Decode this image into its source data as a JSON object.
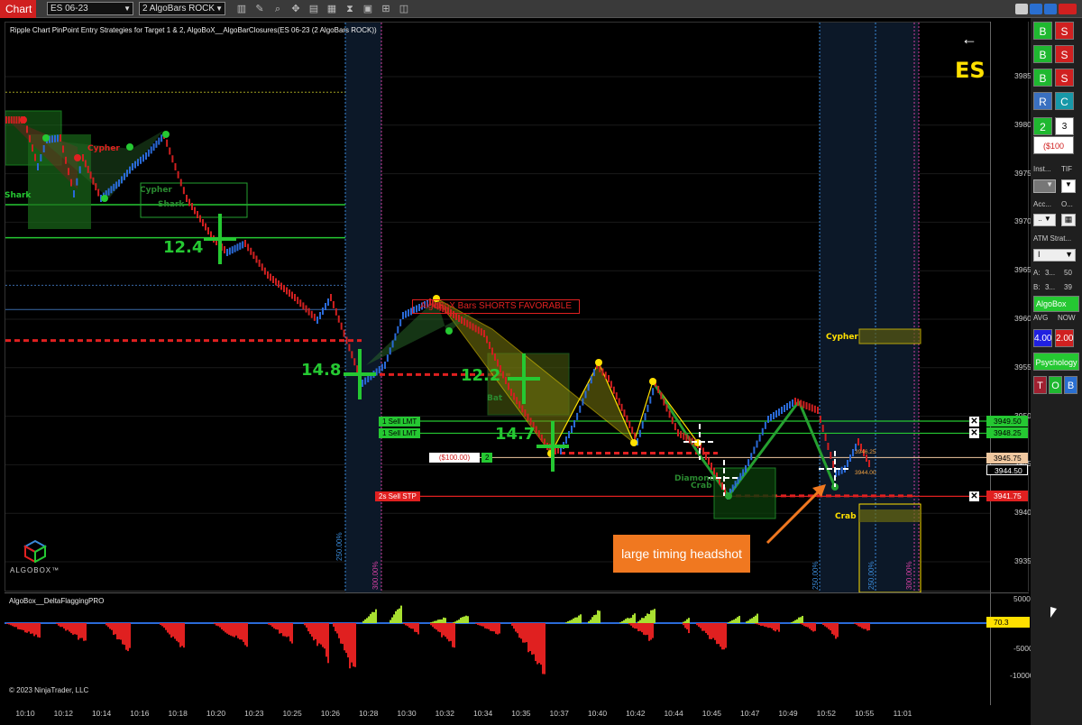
{
  "toolbar": {
    "tab_label": "Chart",
    "instrument": "ES 06-23",
    "bar_type": "2 AlgoBars ROCK",
    "icons": [
      "bar-style-icon",
      "draw-icon",
      "zoom-icon",
      "pointer-icon",
      "page-icon",
      "properties-icon",
      "strategy-icon",
      "template-icon",
      "chart-trader-icon",
      "global-icon"
    ]
  },
  "chart": {
    "title": "Ripple Chart PinPoint Entry Strategies for Target 1 & 2, AlgoBoX__AlgoBarClosures(ES 06-23 (2 AlgoBars ROCK))",
    "symbol_badge": "ES",
    "y_ticks": [
      "3985.00",
      "3980.00",
      "3975.00",
      "3970.00",
      "3965.00",
      "3960.00",
      "3955.00",
      "3950.00",
      "3945.00",
      "3940.00",
      "3935.00"
    ],
    "x_ticks": [
      "10:10",
      "10:12",
      "10:14",
      "10:16",
      "10:18",
      "10:20",
      "10:23",
      "10:25",
      "10:26",
      "10:28",
      "10:30",
      "10:32",
      "10:34",
      "10:35",
      "10:37",
      "10:40",
      "10:42",
      "10:44",
      "10:45",
      "10:47",
      "10:49",
      "10:52",
      "10:55",
      "11:01"
    ],
    "price_tags": [
      {
        "value": "3949.50",
        "color": "#25c832"
      },
      {
        "value": "3948.25",
        "color": "#25c832"
      },
      {
        "value": "3945.75",
        "color": "#f0c8a0"
      },
      {
        "value": "3944.50",
        "color": "#ffffff"
      },
      {
        "value": "3941.75",
        "color": "#e02020"
      }
    ],
    "orders": {
      "sell_lmt_1": "1  Sell LMT",
      "sell_lmt_2": "1  Sell LMT",
      "pnl": "($100.00)",
      "pnl_qty": "2",
      "sell_stp": "2s  Sell STP"
    },
    "small_levels": [
      "3946.25",
      "3944.00"
    ],
    "big_numbers": [
      "12.4",
      "14.8",
      "12.2",
      "14.7"
    ],
    "banner": "AlgoBoX Bars SHORTS FAVORABLE",
    "pattern_labels": [
      "Cypher",
      "Shark",
      "Cypher",
      "Shark",
      "Bat",
      "Diamond",
      "Crab",
      "Cypher",
      "Crab"
    ],
    "vertical_labels": [
      "250.00%",
      "300.00%",
      "250.00%",
      "250.00%",
      "300.00%"
    ],
    "annotation": "large timing headshot",
    "logo_text": "ALGOBOX™"
  },
  "indicator": {
    "title": "AlgoBox__DeltaFlaggingPRO",
    "y_ticks": [
      "5000",
      "-5000",
      "-10000"
    ],
    "value_tag": "70.3",
    "copyright": "© 2023 NinjaTrader, LLC"
  },
  "side_panel": {
    "buttons": [
      {
        "label": "B",
        "color": "#1fb830"
      },
      {
        "label": "S",
        "color": "#d02020"
      },
      {
        "label": "B",
        "color": "#1fb830"
      },
      {
        "label": "S",
        "color": "#d02020"
      },
      {
        "label": "B",
        "color": "#1fb830"
      },
      {
        "label": "S",
        "color": "#d02020"
      },
      {
        "label": "R",
        "color": "#3a70c0"
      },
      {
        "label": "C",
        "color": "#1898a8"
      }
    ],
    "qty": "2",
    "qty2": "3",
    "pnl": "($100",
    "instrument_label": "Inst...",
    "tif_label": "TIF",
    "account_label": "Acc...",
    "o_label": "O...",
    "atm_label": "ATM Strat...",
    "atm_value": "I",
    "a_label": "A:",
    "a_value": "3...",
    "a_qty": "50",
    "b_label": "B:",
    "b_value": "3...",
    "b_qty": "39",
    "algobox_button": "AlgoBox Sp",
    "avg_label": "AVG",
    "now_label": "NOW",
    "avg_value": "4.00",
    "now_value": "2.00",
    "psychology": "Psychology",
    "t_label": "T",
    "o_btn_label": "O",
    "b_btn_label": "B"
  }
}
